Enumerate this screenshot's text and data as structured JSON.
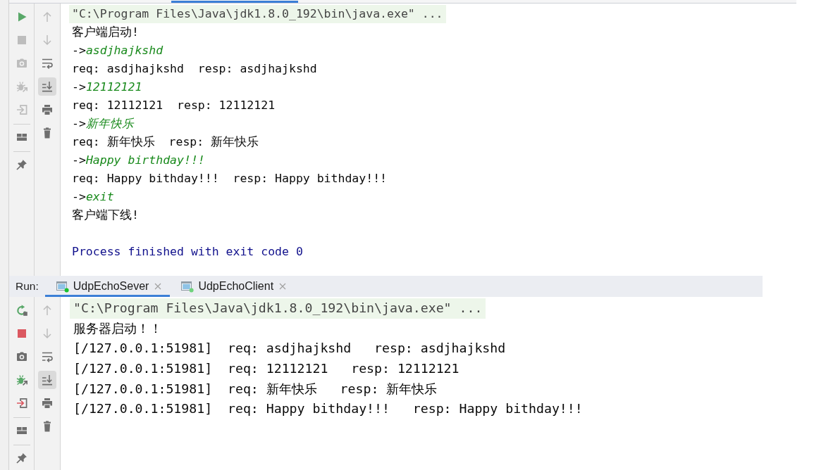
{
  "upper_console": {
    "toolbar": [
      [
        {
          "kind": "run",
          "disabled": false
        },
        {
          "kind": "stop",
          "disabled": true
        },
        {
          "kind": "camera",
          "disabled": true
        },
        {
          "kind": "debug",
          "disabled": true
        },
        {
          "kind": "attach",
          "disabled": true
        }
      ],
      [
        {
          "kind": "layout",
          "disabled": false
        }
      ],
      [
        {
          "kind": "pin",
          "disabled": false
        }
      ]
    ],
    "output_toolbar": [
      {
        "kind": "up",
        "disabled": true,
        "on": false
      },
      {
        "kind": "down",
        "disabled": true,
        "on": false
      },
      {
        "kind": "wrap",
        "disabled": false,
        "on": false
      },
      {
        "kind": "scroll_end",
        "disabled": false,
        "on": true
      },
      {
        "kind": "print",
        "disabled": false,
        "on": false
      },
      {
        "kind": "trash",
        "disabled": false,
        "on": false
      }
    ],
    "lines": [
      {
        "kind": "command",
        "text": "\"C:\\Program Files\\Java\\jdk1.8.0_192\\bin\\java.exe\" ..."
      },
      {
        "kind": "output",
        "text": "客户端启动!"
      },
      {
        "kind": "input",
        "prompt": "->",
        "text": "asdjhajkshd"
      },
      {
        "kind": "output",
        "text": "req: asdjhajkshd  resp: asdjhajkshd"
      },
      {
        "kind": "input",
        "prompt": "->",
        "text": "12112121"
      },
      {
        "kind": "output",
        "text": "req: 12112121  resp: 12112121"
      },
      {
        "kind": "input",
        "prompt": "->",
        "text": "新年快乐"
      },
      {
        "kind": "output",
        "text": "req: 新年快乐  resp: 新年快乐"
      },
      {
        "kind": "input",
        "prompt": "->",
        "text": "Happy birthday!!!"
      },
      {
        "kind": "output",
        "text": "req: Happy bithday!!!  resp: Happy bithday!!!"
      },
      {
        "kind": "input",
        "prompt": "->",
        "text": "exit"
      },
      {
        "kind": "output",
        "text": "客户端下线!"
      },
      {
        "kind": "system",
        "text": "Process finished with exit code 0"
      }
    ]
  },
  "run_panel": {
    "label": "Run:",
    "tabs": [
      {
        "label": "UdpEchoSever",
        "selected": true
      },
      {
        "label": "UdpEchoClient",
        "selected": false
      }
    ],
    "toolbar": [
      [
        {
          "kind": "rerun",
          "disabled": false
        },
        {
          "kind": "stop",
          "disabled": false
        },
        {
          "kind": "camera",
          "disabled": false
        },
        {
          "kind": "debug",
          "disabled": false
        },
        {
          "kind": "attach",
          "disabled": false
        }
      ],
      [
        {
          "kind": "layout",
          "disabled": false
        }
      ],
      [
        {
          "kind": "pin",
          "disabled": false
        }
      ]
    ],
    "output_toolbar": [
      {
        "kind": "up",
        "disabled": true,
        "on": false
      },
      {
        "kind": "down",
        "disabled": true,
        "on": false
      },
      {
        "kind": "wrap",
        "disabled": false,
        "on": false
      },
      {
        "kind": "scroll_end",
        "disabled": false,
        "on": true
      },
      {
        "kind": "print",
        "disabled": false,
        "on": false
      },
      {
        "kind": "trash",
        "disabled": false,
        "on": false
      }
    ],
    "lines": [
      {
        "kind": "command",
        "text": "\"C:\\Program Files\\Java\\jdk1.8.0_192\\bin\\java.exe\" ..."
      },
      {
        "kind": "output",
        "text": "服务器启动！！"
      },
      {
        "kind": "output",
        "text": "[/127.0.0.1:51981]  req: asdjhajkshd   resp: asdjhajkshd"
      },
      {
        "kind": "output",
        "text": "[/127.0.0.1:51981]  req: 12112121   resp: 12112121"
      },
      {
        "kind": "output",
        "text": "[/127.0.0.1:51981]  req: 新年快乐   resp: 新年快乐"
      },
      {
        "kind": "output",
        "text": "[/127.0.0.1:51981]  req: Happy bithday!!!   resp: Happy bithday!!!"
      }
    ]
  }
}
